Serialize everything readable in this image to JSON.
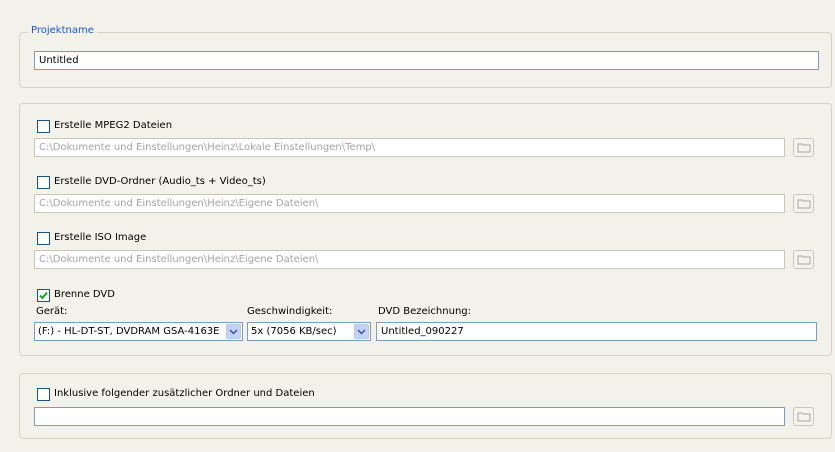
{
  "project": {
    "legend": "Projektname",
    "name_value": "Untitled"
  },
  "output": {
    "mpeg2": {
      "label": "Erstelle MPEG2 Dateien",
      "checked": false,
      "path": "C:\\Dokumente und Einstellungen\\Heinz\\Lokale Einstellungen\\Temp\\"
    },
    "dvd_folder": {
      "label": "Erstelle DVD-Ordner (Audio_ts + Video_ts)",
      "checked": false,
      "path": "C:\\Dokumente und Einstellungen\\Heinz\\Eigene Dateien\\"
    },
    "iso": {
      "label": "Erstelle ISO Image",
      "checked": false,
      "path": "C:\\Dokumente und Einstellungen\\Heinz\\Eigene Dateien\\"
    },
    "burn": {
      "label": "Brenne DVD",
      "checked": true,
      "device_label": "Gerät:",
      "device_value": "(F:) - HL-DT-ST, DVDRAM GSA-4163E",
      "speed_label": "Geschwindigkeit:",
      "speed_value": "5x (7056 KB/sec)",
      "dvdname_label": "DVD Bezeichnung:",
      "dvdname_value": "Untitled_090227"
    }
  },
  "extra": {
    "label": "Inklusive folgender zusätzlicher Ordner und Dateien",
    "checked": false,
    "path": ""
  },
  "icons": {
    "browse": "folder-icon",
    "dropdown": "chevron-down-icon",
    "check": "checkmark-icon"
  },
  "colors": {
    "background": "#f2f1ea",
    "legend": "#1c56d8",
    "check": "#21a121",
    "field_border": "#7f9db9"
  }
}
